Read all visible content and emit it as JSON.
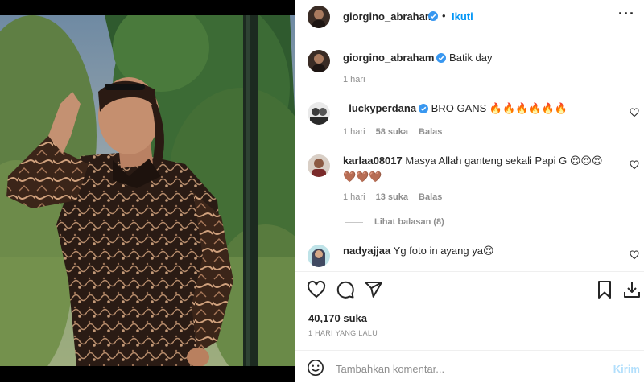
{
  "post": {
    "author": "giorgino_abraham",
    "follow_label": "Ikuti",
    "caption": "Batik day",
    "caption_age": "1 hari",
    "likes": "40,170 suka",
    "timestamp": "1 HARI YANG LALU"
  },
  "comments": [
    {
      "user": "_luckyperdana",
      "verified": true,
      "text": "BRO GANS 🔥🔥🔥🔥🔥🔥",
      "age": "1 hari",
      "likes": "58 suka",
      "reply": "Balas"
    },
    {
      "user": "karlaa08017",
      "verified": false,
      "text": "Masya Allah ganteng sekali Papi G 😍😍😍🤎🤎🤎",
      "age": "1 hari",
      "likes": "13 suka",
      "reply": "Balas",
      "view_replies": "Lihat balasan (8)"
    },
    {
      "user": "nadyajjaa",
      "verified": false,
      "text": "Yg foto in ayang ya😍"
    }
  ],
  "add_comment": {
    "placeholder": "Tambahkan komentar...",
    "post_label": "Kirim"
  },
  "colors": {
    "accent": "#0095f6",
    "verified": "#3897f0",
    "muted": "#8e8e8e"
  }
}
